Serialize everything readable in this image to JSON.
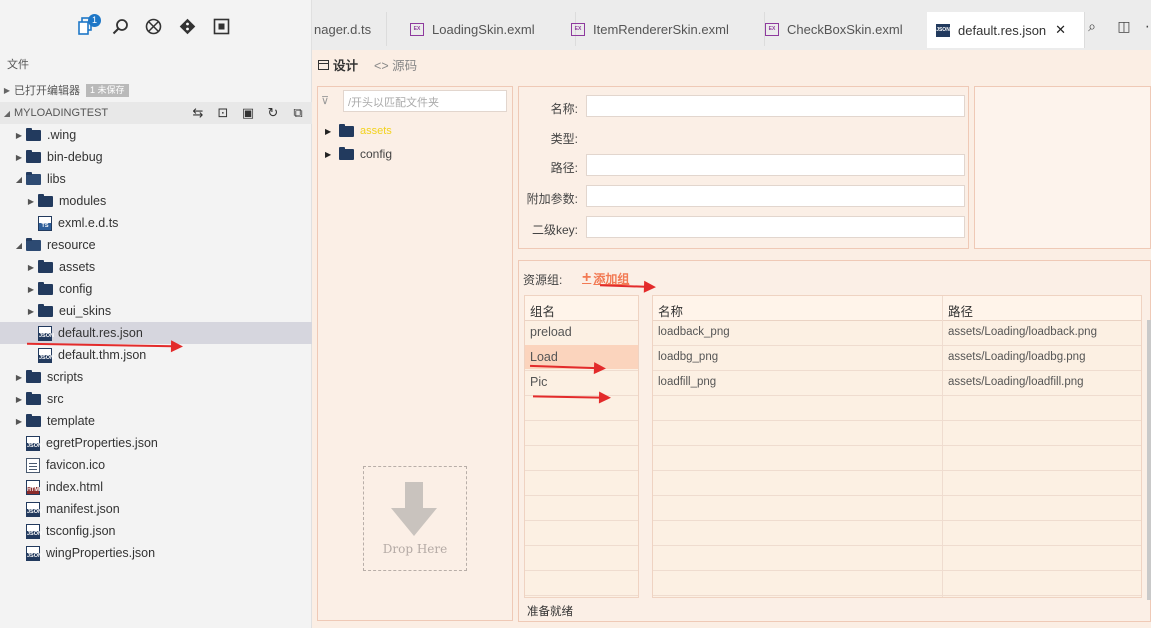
{
  "activity": {
    "explorer_badge": "1"
  },
  "sidebar": {
    "title": "文件",
    "open_editors": {
      "label": "已打开编辑器",
      "badge": "1 未保存"
    },
    "project": {
      "label": "MYLOADINGTEST"
    },
    "tree": [
      {
        "label": ".wing",
        "kind": "folder",
        "depth": 1,
        "state": "closed"
      },
      {
        "label": "bin-debug",
        "kind": "folder",
        "depth": 1,
        "state": "closed"
      },
      {
        "label": "libs",
        "kind": "folder",
        "depth": 1,
        "state": "open"
      },
      {
        "label": "modules",
        "kind": "folder",
        "depth": 2,
        "state": "closed"
      },
      {
        "label": "exml.e.d.ts",
        "kind": "ts",
        "depth": 2
      },
      {
        "label": "resource",
        "kind": "folder",
        "depth": 1,
        "state": "open"
      },
      {
        "label": "assets",
        "kind": "folder",
        "depth": 2,
        "state": "closed"
      },
      {
        "label": "config",
        "kind": "folder",
        "depth": 2,
        "state": "closed"
      },
      {
        "label": "eui_skins",
        "kind": "folder",
        "depth": 2,
        "state": "closed"
      },
      {
        "label": "default.res.json",
        "kind": "json",
        "depth": 2,
        "selected": true
      },
      {
        "label": "default.thm.json",
        "kind": "json",
        "depth": 2
      },
      {
        "label": "scripts",
        "kind": "folder",
        "depth": 1,
        "state": "closed"
      },
      {
        "label": "src",
        "kind": "folder",
        "depth": 1,
        "state": "closed"
      },
      {
        "label": "template",
        "kind": "folder",
        "depth": 1,
        "state": "closed"
      },
      {
        "label": "egretProperties.json",
        "kind": "json",
        "depth": 1
      },
      {
        "label": "favicon.ico",
        "kind": "plain",
        "depth": 1
      },
      {
        "label": "index.html",
        "kind": "html",
        "depth": 1
      },
      {
        "label": "manifest.json",
        "kind": "json",
        "depth": 1
      },
      {
        "label": "tsconfig.json",
        "kind": "json",
        "depth": 1
      },
      {
        "label": "wingProperties.json",
        "kind": "json",
        "depth": 1
      }
    ]
  },
  "tabs": [
    {
      "label": "nager.d.ts",
      "icon": "none"
    },
    {
      "label": "LoadingSkin.exml",
      "icon": "exml"
    },
    {
      "label": "ItemRendererSkin.exml",
      "icon": "exml"
    },
    {
      "label": "CheckBoxSkin.exml",
      "icon": "exml"
    },
    {
      "label": "default.res.json",
      "icon": "json",
      "active": true
    }
  ],
  "editor": {
    "view_design": "设计",
    "view_source": "<> 源码",
    "filter_placeholder": "/开头以匹配文件夹",
    "resource_tree": [
      {
        "label": "assets",
        "highlight": true
      },
      {
        "label": "config",
        "highlight": false
      }
    ],
    "drop_here": "Drop Here",
    "props": {
      "name_label": "名称:",
      "type_label": "类型:",
      "path_label": "路径:",
      "params_label": "附加参数:",
      "subkey_label": "二级key:"
    },
    "groups": {
      "label": "资源组:",
      "add_label": "添加组",
      "group_header": "组名",
      "items": [
        "preload",
        "Load",
        "Pic"
      ],
      "selected": "Load"
    },
    "resources": {
      "name_header": "名称",
      "path_header": "路径",
      "rows": [
        {
          "name": "loadback_png",
          "path": "assets/Loading/loadback.png"
        },
        {
          "name": "loadbg_png",
          "path": "assets/Loading/loadbg.png"
        },
        {
          "name": "loadfill_png",
          "path": "assets/Loading/loadfill.png"
        }
      ]
    },
    "status": "准备就绪"
  }
}
